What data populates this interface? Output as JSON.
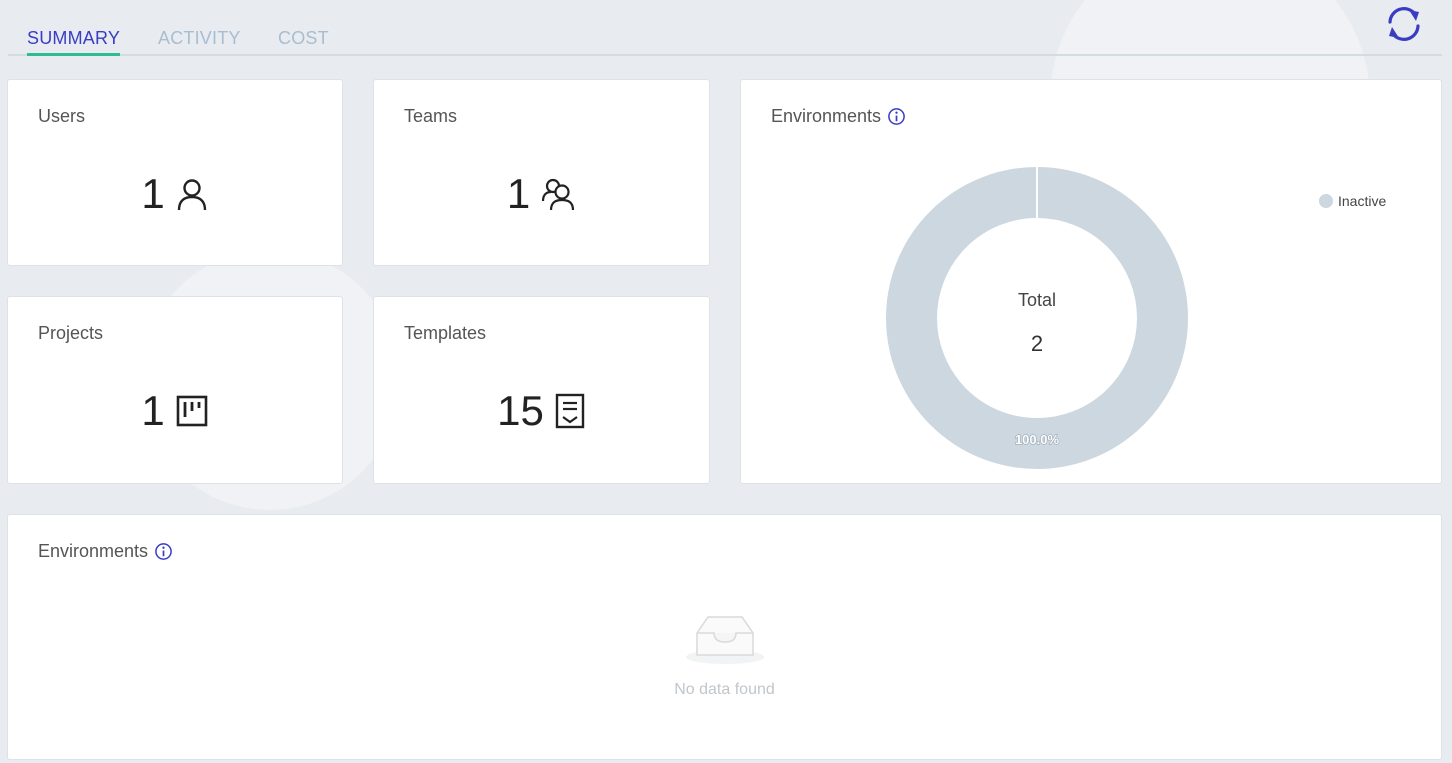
{
  "tabs": [
    {
      "label": "SUMMARY",
      "active": true
    },
    {
      "label": "ACTIVITY",
      "active": false
    },
    {
      "label": "COST",
      "active": false
    }
  ],
  "colors": {
    "accent": "#3a3dc4",
    "tab_underline": "#2dbd8e",
    "tab_inactive": "#a9bdd0",
    "donut_inactive": "#ccd7e0"
  },
  "stats": {
    "users": {
      "title": "Users",
      "value": "1",
      "icon": "user-icon"
    },
    "teams": {
      "title": "Teams",
      "value": "1",
      "icon": "team-icon"
    },
    "projects": {
      "title": "Projects",
      "value": "1",
      "icon": "board-icon"
    },
    "templates": {
      "title": "Templates",
      "value": "15",
      "icon": "template-icon"
    }
  },
  "environments_chart": {
    "title": "Environments",
    "center_label": "Total",
    "center_value": "2",
    "legend": [
      {
        "label": "Inactive",
        "color": "#ccd7e0"
      }
    ]
  },
  "chart_data": {
    "type": "pie",
    "categories": [
      "Inactive"
    ],
    "values": [
      100.0
    ],
    "data_labels": [
      "100.0%"
    ],
    "total": 2,
    "legend_placement": "top-right"
  },
  "environments_table": {
    "title": "Environments",
    "empty_text": "No data found"
  }
}
